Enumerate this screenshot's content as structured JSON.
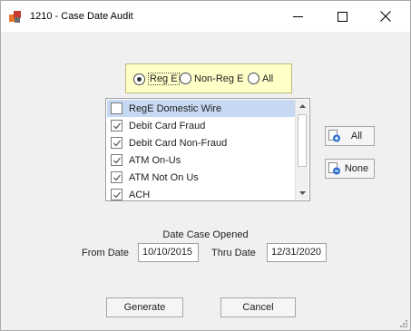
{
  "window": {
    "title": "1210 - Case Date Audit",
    "controls": {
      "minimize": "minimize-icon",
      "maximize": "maximize-icon",
      "close": "close-icon"
    }
  },
  "filter": {
    "options": [
      {
        "label": "Reg E",
        "selected": true
      },
      {
        "label": "Non-Reg E",
        "selected": false
      },
      {
        "label": "All",
        "selected": false
      }
    ]
  },
  "list": {
    "items": [
      {
        "label": "RegE Domestic Wire",
        "checked": false,
        "selected": true
      },
      {
        "label": "Debit Card Fraud",
        "checked": true,
        "selected": false
      },
      {
        "label": "Debit Card Non-Fraud",
        "checked": true,
        "selected": false
      },
      {
        "label": "ATM On-Us",
        "checked": true,
        "selected": false
      },
      {
        "label": "ATM Not On Us",
        "checked": true,
        "selected": false
      },
      {
        "label": "ACH",
        "checked": true,
        "selected": false
      }
    ]
  },
  "side_buttons": {
    "all_label": "All",
    "none_label": "None"
  },
  "dates": {
    "caption": "Date Case Opened",
    "from_label": "From Date",
    "from_value": "10/10/2015",
    "thru_label": "Thru Date",
    "thru_value": "12/31/2020"
  },
  "actions": {
    "generate_label": "Generate",
    "cancel_label": "Cancel"
  },
  "colors": {
    "radio_panel_bg": "#ffffc8",
    "selected_row": "#c7d9f2",
    "plus_icon": "#2f6fcf",
    "minus_icon": "#2f6fcf"
  }
}
